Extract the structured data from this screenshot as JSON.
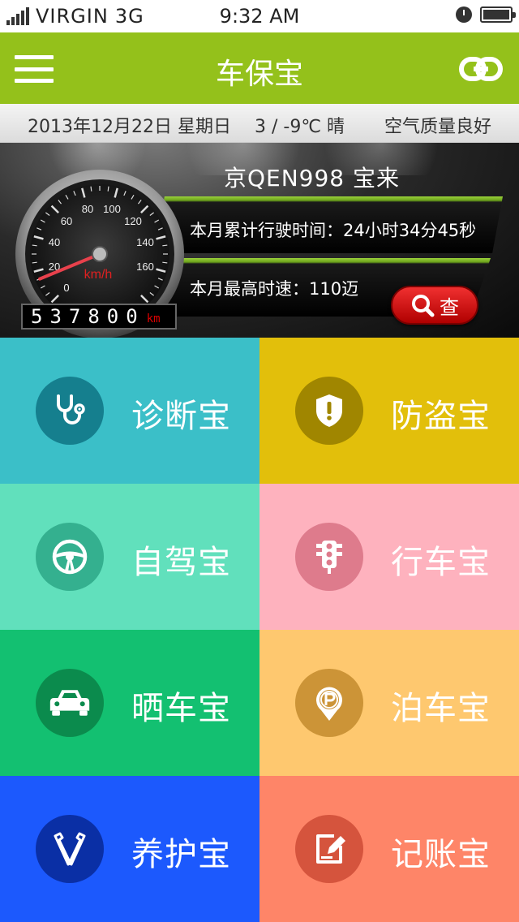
{
  "status_bar": {
    "carrier": "VIRGIN",
    "network": "3G",
    "time": "9:32  AM"
  },
  "header": {
    "title": "车保宝"
  },
  "info_bar": {
    "date": "2013年12月22日 星期日",
    "weather": "3 / -9℃   晴",
    "air_quality": "空气质量良好"
  },
  "dashboard": {
    "car_name": "京QEN998    宝来",
    "monthly_drive_time": "本月累计行驶时间：24小时34分45秒",
    "monthly_max_speed": "本月最高时速：110迈",
    "search_label": "查",
    "odometer_value": "537800",
    "odometer_unit": "km",
    "gauge_unit": "km/h",
    "gauge_ticks": [
      "0",
      "20",
      "40",
      "60",
      "80",
      "100",
      "120",
      "140",
      "160"
    ],
    "gauge_needle_value": 15
  },
  "tiles": [
    {
      "label": "诊断宝",
      "icon": "stethoscope-icon",
      "bg": "#3bbfc8",
      "circle": "#157f8e"
    },
    {
      "label": "防盗宝",
      "icon": "shield-icon",
      "bg": "#e2bf0b",
      "circle": "#a08600"
    },
    {
      "label": "自驾宝",
      "icon": "steering-wheel-icon",
      "bg": "#61e0bc",
      "circle": "#34b08f"
    },
    {
      "label": "行车宝",
      "icon": "traffic-light-icon",
      "bg": "#feb2be",
      "circle": "#de7b8c"
    },
    {
      "label": "晒车宝",
      "icon": "car-icon",
      "bg": "#13c071",
      "circle": "#0b8b4d"
    },
    {
      "label": "泊车宝",
      "icon": "parking-icon",
      "bg": "#fec86f",
      "circle": "#cc9437"
    },
    {
      "label": "养护宝",
      "icon": "wrench-icon",
      "bg": "#1c59fd",
      "circle": "#0a2fa5"
    },
    {
      "label": "记账宝",
      "icon": "note-edit-icon",
      "bg": "#fe8568",
      "circle": "#d5543d"
    }
  ],
  "colors": {
    "header_green": "#94c11b",
    "search_red": "#e02020"
  }
}
